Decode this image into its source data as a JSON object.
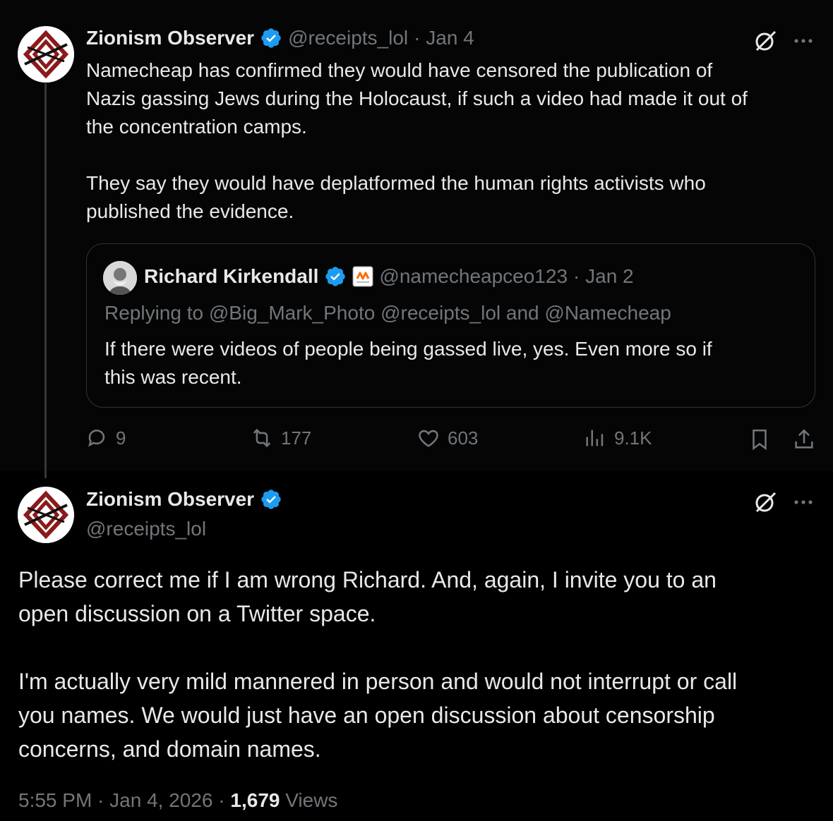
{
  "tweet1": {
    "name": "Zionism Observer",
    "handle": "@receipts_lol",
    "date": "· Jan 4",
    "text": "Namecheap has confirmed they would have censored the publication of\nNazis gassing Jews during the Holocaust, if such a video had made it out of\nthe concentration camps.\n\nThey say they would have deplatformed the human rights activists who\npublished the evidence.",
    "quote": {
      "name": "Richard Kirkendall",
      "handle": "@namecheapceo123",
      "date": "· Jan 2",
      "replying_prefix": "Replying to",
      "replying_to": "@Big_Mark_Photo @receipts_lol and @Namecheap",
      "text": "If there were videos of people being gassed live, yes. Even more so if\nthis was recent."
    },
    "actions": {
      "replies": "9",
      "reposts": "177",
      "likes": "603",
      "views": "9.1K"
    }
  },
  "tweet2": {
    "name": "Zionism Observer",
    "handle": "@receipts_lol",
    "text": "Please correct me if I am wrong Richard. And, again, I invite you to an\nopen discussion on a Twitter space.\n\nI'm actually very mild mannered in person and would not interrupt or call\nyou names. We would just have an open discussion about censorship\nconcerns, and domain names.",
    "time": "5:55 PM · Jan 4, 2026 ·",
    "views_count": "1,679",
    "views_label": "Views"
  },
  "colors": {
    "background": "#000000",
    "text": "#e7e9ea",
    "muted": "#71767b",
    "verified": "#1d9bf0",
    "logo_red": "#8b1a1a"
  },
  "icons": [
    "verified-badge-icon",
    "grok-icon",
    "more-icon",
    "reply-icon",
    "repost-icon",
    "like-icon",
    "views-icon",
    "bookmark-icon",
    "share-icon",
    "namecheap-logo-icon"
  ]
}
